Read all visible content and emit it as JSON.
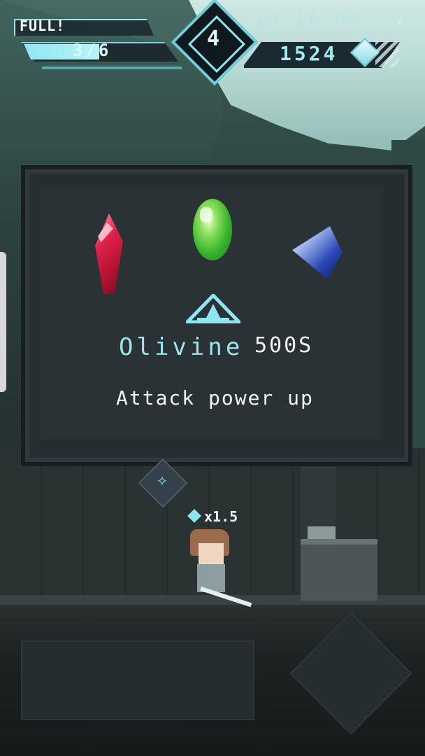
{
  "hud": {
    "status_label": "FULL!",
    "hp_text": "3/6",
    "hp_fraction": 0.5,
    "level_number": "4",
    "faded_top_right": "10 10 00",
    "gem_count": "1524"
  },
  "panel": {
    "gems": [
      {
        "name": "ruby-gem",
        "color": "#e0204a"
      },
      {
        "name": "olivine-gem",
        "color": "#36b22c"
      },
      {
        "name": "sapphire-gem",
        "color": "#2b49b6"
      }
    ],
    "selected_name": "Olivine",
    "selected_price": "500S",
    "selected_description": "Attack power up"
  },
  "character": {
    "multiplier": "x1.5"
  },
  "colors": {
    "accent": "#8fe6f0",
    "panel_bg": "#252d31"
  }
}
